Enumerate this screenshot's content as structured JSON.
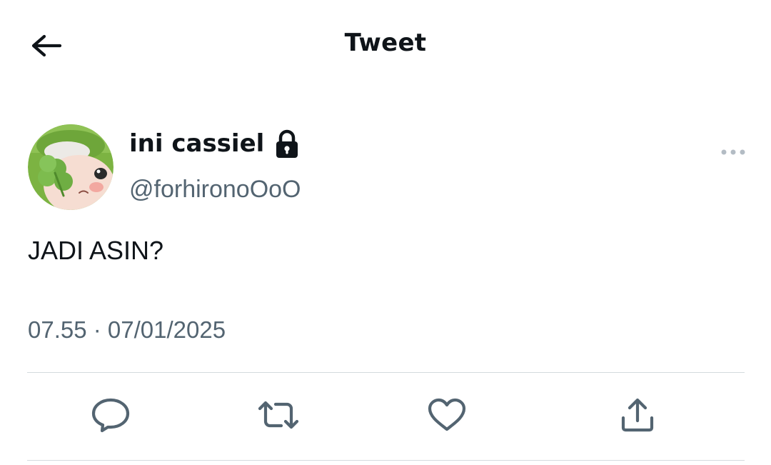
{
  "header": {
    "title": "Tweet",
    "back_icon": "arrow-left-icon"
  },
  "tweet": {
    "author": {
      "display_name": "ini cassiel",
      "handle": "@forhironoOoO",
      "protected": true,
      "avatar_description": "avatar-image"
    },
    "text": "JADI ASIN?",
    "timestamp": "07.55 · 07/01/2025"
  },
  "actions": [
    {
      "name": "reply",
      "icon": "reply-icon"
    },
    {
      "name": "retweet",
      "icon": "retweet-icon"
    },
    {
      "name": "like",
      "icon": "heart-icon"
    },
    {
      "name": "share",
      "icon": "share-icon"
    }
  ],
  "colors": {
    "text_primary": "#0f1419",
    "text_secondary": "#536471",
    "divider": "#d4dade",
    "avatar_green": "#7cb342"
  }
}
